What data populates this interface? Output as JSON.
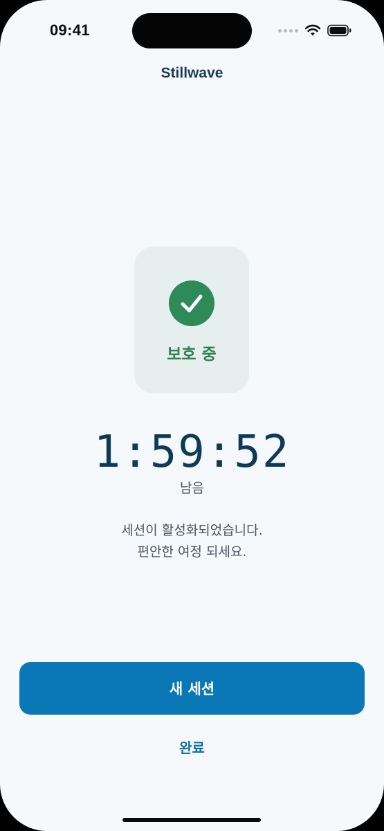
{
  "status_bar": {
    "time": "09:41",
    "icons": [
      "signal-dots-icon",
      "wifi-icon",
      "battery-icon"
    ]
  },
  "nav": {
    "title": "Stillwave"
  },
  "protection": {
    "label": "보호 중",
    "icon": "checkmark-icon",
    "status_color": "#2e8a59"
  },
  "timer": {
    "value": "1:59:52",
    "caption": "남음"
  },
  "message": {
    "line1": "세션이 활성화되었습니다.",
    "line2": "편안한 여정 되세요."
  },
  "actions": {
    "primary_label": "새 세션",
    "secondary_label": "완료",
    "accent_color": "#0a77b6"
  }
}
